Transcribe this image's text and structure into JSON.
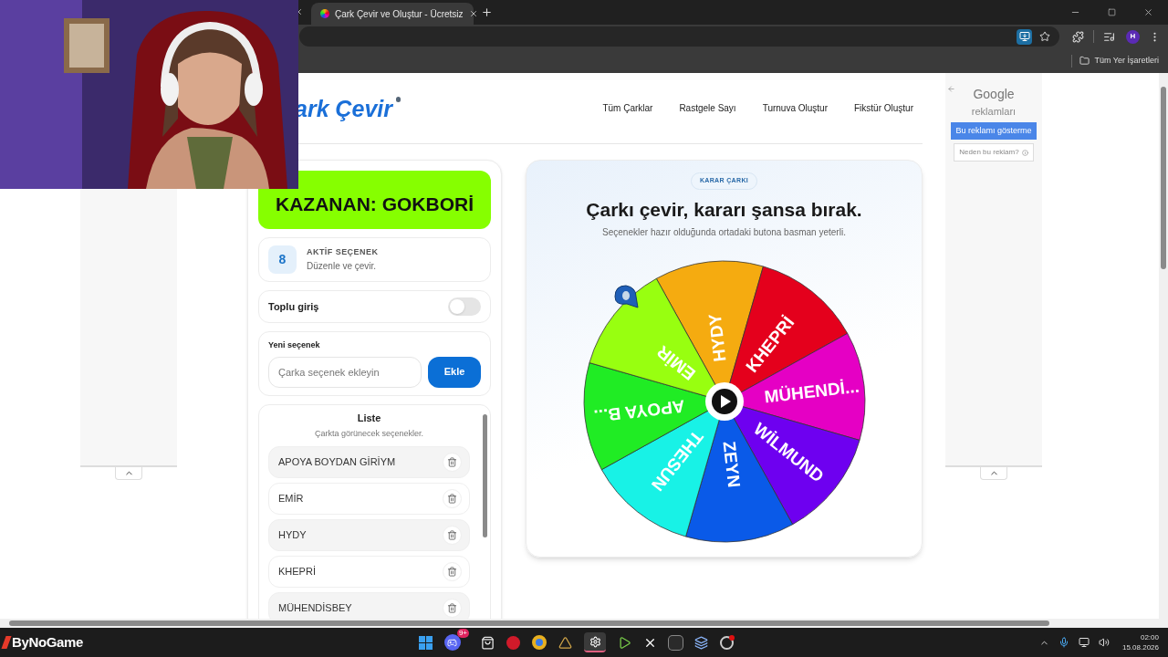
{
  "browser": {
    "tabs": [
      {
        "title": "Çark Çevir ve Oluştur - Ücretsiz",
        "selected": true
      }
    ],
    "profile_initial": "H",
    "bookmarks": [
      "Tüm Yer İşaretleri"
    ]
  },
  "site": {
    "logo": "ark Çevir",
    "nav": [
      "Tüm Çarklar",
      "Rastgele Sayı",
      "Turnuva Oluştur",
      "Fikstür Oluştur"
    ]
  },
  "winner": "KAZANAN: GOKBORİ",
  "active_count": {
    "value": "8",
    "title": "AKTİF SEÇENEK",
    "subtitle": "Düzenle ve çevir."
  },
  "bulk_entry": {
    "label": "Toplu giriş",
    "on": false
  },
  "new_option": {
    "label": "Yeni seçenek",
    "placeholder": "Çarka seçenek ekleyin",
    "button": "Ekle"
  },
  "list": {
    "title": "Liste",
    "subtitle": "Çarkta görünecek seçenekler.",
    "items": [
      {
        "label": "APOYA BOYDAN GİRİYM"
      },
      {
        "label": "EMİR"
      },
      {
        "label": "HYDY"
      },
      {
        "label": "KHEPRİ"
      },
      {
        "label": "MÜHENDİSBEY"
      }
    ]
  },
  "wheel_card": {
    "badge": "KARAR ÇARKI",
    "heading": "Çarkı çevir, kararı şansa bırak.",
    "subtitle": "Seçenekler hazır olduğunda ortadaki butona basman yeterli.",
    "segments": [
      {
        "label": "HYDY",
        "color": "#f5ab10"
      },
      {
        "label": "KHEPRİ",
        "color": "#e4001c"
      },
      {
        "label": "MÜHENDİ...",
        "color": "#e500c4"
      },
      {
        "label": "WİLMUND",
        "color": "#6e00f0"
      },
      {
        "label": "ZEYN",
        "color": "#0a5ae8"
      },
      {
        "label": "THESUN",
        "color": "#18f2e6"
      },
      {
        "label": "APOYA B...",
        "color": "#20ec24"
      },
      {
        "label": "EMİR",
        "color": "#98ff10"
      }
    ]
  },
  "ad": {
    "title": "Google",
    "subtitle": "reklamları",
    "hide_button": "Bu reklamı gösterme",
    "why_button": "Neden bu reklam?"
  },
  "taskbar": {
    "overlay_logo": "ByNoGame",
    "badge": "9+",
    "time": "02:00",
    "date": "15.08.2026"
  }
}
